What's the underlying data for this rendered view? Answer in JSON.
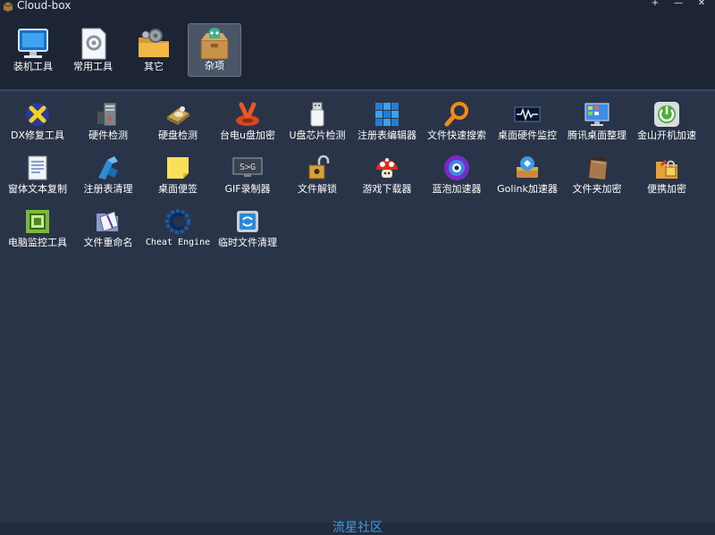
{
  "window": {
    "title": "Cloud-box",
    "controls": [
      "+",
      "—",
      "✕"
    ]
  },
  "tabs": [
    {
      "label": "装机工具",
      "icon": "monitor-icon"
    },
    {
      "label": "常用工具",
      "icon": "settings-doc-icon"
    },
    {
      "label": "其它",
      "icon": "gear-folder-icon"
    },
    {
      "label": "杂项",
      "icon": "box-icon",
      "active": true
    }
  ],
  "tools": [
    {
      "label": "DX修复工具",
      "icon": "dx-repair-icon"
    },
    {
      "label": "硬件检测",
      "icon": "hardware-check-icon"
    },
    {
      "label": "硬盘检测",
      "icon": "disk-check-icon"
    },
    {
      "label": "台电u盘加密",
      "icon": "usb-encrypt-icon"
    },
    {
      "label": "U盘芯片检测",
      "icon": "usb-chip-icon"
    },
    {
      "label": "注册表编辑器",
      "icon": "registry-editor-icon"
    },
    {
      "label": "文件快速搜索",
      "icon": "file-search-icon"
    },
    {
      "label": "桌面硬件监控",
      "icon": "hardware-monitor-icon"
    },
    {
      "label": "腾讯桌面整理",
      "icon": "desktop-organize-icon"
    },
    {
      "label": "金山开机加速",
      "icon": "boot-speedup-icon"
    },
    {
      "label": "窗体文本复制",
      "icon": "window-text-copy-icon"
    },
    {
      "label": "注册表清理",
      "icon": "registry-clean-icon"
    },
    {
      "label": "桌面便签",
      "icon": "sticky-note-icon"
    },
    {
      "label": "GIF录制器",
      "icon": "gif-recorder-icon"
    },
    {
      "label": "文件解锁",
      "icon": "file-unlock-icon"
    },
    {
      "label": "游戏下载器",
      "icon": "game-downloader-icon"
    },
    {
      "label": "蓝泡加速器",
      "icon": "bubble-accelerator-icon"
    },
    {
      "label": "Golink加速器",
      "icon": "golink-accelerator-icon"
    },
    {
      "label": "文件夹加密",
      "icon": "folder-encrypt-icon"
    },
    {
      "label": "便携加密",
      "icon": "portable-encrypt-icon"
    },
    {
      "label": "电脑监控工具",
      "icon": "pc-monitor-icon"
    },
    {
      "label": "文件重命名",
      "icon": "file-rename-icon"
    },
    {
      "label": "Cheat Engine",
      "icon": "cheat-engine-icon"
    },
    {
      "label": "临时文件清理",
      "icon": "temp-clean-icon"
    }
  ],
  "footer": {
    "text": "流星社区"
  }
}
